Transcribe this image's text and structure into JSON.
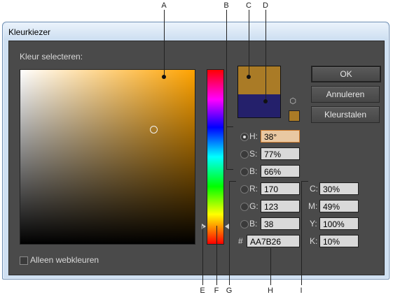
{
  "window": {
    "title": "Kleurkiezer"
  },
  "picker": {
    "select_label": "Kleur selecteren:",
    "web_colors_label": "Alleen webkleuren"
  },
  "colors": {
    "selected": "#AA7B26",
    "current": "#24206b",
    "field_hue": "#ffa300"
  },
  "swatch": {
    "cube_icon": "cube-icon"
  },
  "buttons": {
    "ok": "OK",
    "cancel": "Annuleren",
    "swatches": "Kleurstalen"
  },
  "hsb": [
    {
      "label": "H:",
      "value": "38°"
    },
    {
      "label": "S:",
      "value": "77%"
    },
    {
      "label": "B:",
      "value": "66%"
    }
  ],
  "rgb": [
    {
      "label": "R:",
      "value": "170"
    },
    {
      "label": "G:",
      "value": "123"
    },
    {
      "label": "B:",
      "value": "38"
    }
  ],
  "hex": {
    "label": "#",
    "value": "AA7B26"
  },
  "cmyk": [
    {
      "label": "C:",
      "value": "30%"
    },
    {
      "label": "M:",
      "value": "49%"
    },
    {
      "label": "Y:",
      "value": "100%"
    },
    {
      "label": "K:",
      "value": "10%"
    }
  ],
  "callouts": {
    "A": "A",
    "B": "B",
    "C": "C",
    "D": "D",
    "E": "E",
    "F": "F",
    "G": "G",
    "H": "H",
    "I": "I"
  }
}
